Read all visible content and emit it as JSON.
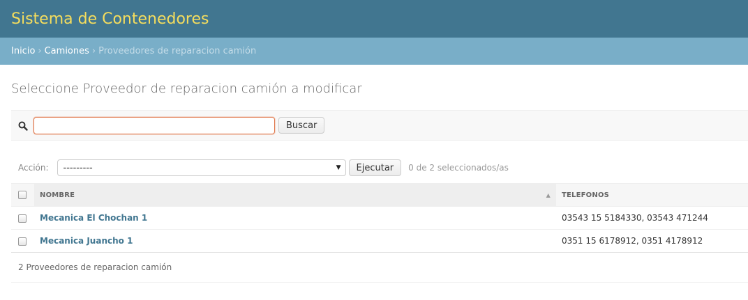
{
  "header": {
    "title": "Sistema de Contenedores"
  },
  "breadcrumbs": {
    "home": "Inicio",
    "section": "Camiones",
    "current": "Proveedores de reparacion camión",
    "separator": "›"
  },
  "page": {
    "title": "Seleccione Proveedor de reparacion camión a modificar"
  },
  "search": {
    "value": "",
    "placeholder": "",
    "button_label": "Buscar"
  },
  "actions": {
    "label": "Acción:",
    "selected": "---------",
    "run_label": "Ejecutar",
    "counter": "0 de 2 seleccionados/as"
  },
  "table": {
    "columns": [
      "Nombre",
      "Telefonos"
    ],
    "rows": [
      {
        "nombre": "Mecanica El Chochan 1",
        "telefonos": "03543 15 5184330, 03543 471244"
      },
      {
        "nombre": "Mecanica Juancho 1",
        "telefonos": "0351 15 6178912, 0351 4178912"
      }
    ]
  },
  "paginator": {
    "text": "2 Proveedores de reparacion camión"
  },
  "colors": {
    "header_bg": "#417690",
    "branding": "#f5dd5d",
    "breadcrumbs_bg": "#79aec8",
    "link": "#417690"
  }
}
